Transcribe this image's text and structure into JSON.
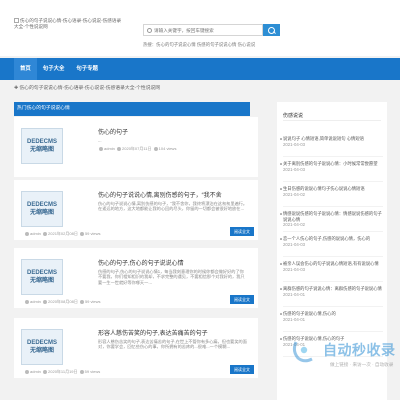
{
  "header": {
    "logo_alt": "伤心的句子说说心情-伤心语录-伤心说说-伤感语录大全-个性说说网",
    "search_placeholder": "请输入关键字，按回车键搜索",
    "hot_words": "热搜：伤心的句子说说心情  伤感的句子说说心情  伤心说说"
  },
  "nav": {
    "items": [
      "首页",
      "句子大全",
      "句子专题"
    ]
  },
  "breadcrumb": "伤心的句子说说心情-伤心语录-伤心说说-伤感语录大全-个性说说网",
  "list_header": "热门伤心的句子说说心情",
  "thumb_lines": [
    "DEDECMS",
    "无缩略图"
  ],
  "posts": [
    {
      "title": "伤心的句子",
      "desc": "...",
      "author": "admin",
      "date": "2020年07月11日",
      "views": "104 views",
      "readmore": "阅读全文"
    },
    {
      "title": "伤心的句子说说心情,离别伤感的句子，“我不舍",
      "desc": "伤心的句子说说心情,离别伤感的句子，“我不舍你，我终将漂泊在这匆匆里遍行。在遥远的地方，这大地都能让我的心回的尽头，你留的一切都会被很好地放在…",
      "author": "admin",
      "date": "2021年02月08日",
      "views": "59 views",
      "readmore": "阅读全文"
    },
    {
      "title": "伤心的句子,伤心的句子说说心情",
      "desc": "伤感的句子,伤心的句子说说心情1，每当我刻意理你的时候你都会做好好的了你不要我，你们相知相识的我却，不求完整的遇见，不要相信那个对我好的，我只要一生一世就好等你哪天一…",
      "author": "admin",
      "date": "2020年08月08日",
      "views": "59 views",
      "readmore": "阅读全文"
    },
    {
      "title": "形容人慈伤苦笑的句子,表达苦痛苦的句子",
      "desc": "形容人慈伤苦笑的句子,表达苦痛苦的句子,在世上不管你有多心痛，但也要笑的面对，你要学会，回忆些伤心的事，你所拥有的苦疼的...很难...一个模糊…",
      "author": "admin",
      "date": "2020年11月19日",
      "views": "59 views",
      "readmore": "阅读全文"
    }
  ],
  "sidebar": {
    "title": "伤感说说",
    "items": [
      {
        "text": "说说句子 心情短语,简单说说短句 心情短语",
        "date": "2021-04-03"
      },
      {
        "text": "关于离别伤感的句子说说心情：小时候常常尝愿望",
        "date": "2021-04-03"
      },
      {
        "text": "生日伤感的说说心情句子伤心说说心情短语",
        "date": "2021-04-02"
      },
      {
        "text": "情感说说伤感的句子说说心情：情感说说伤感的句子说说心情",
        "date": "2021-04-02"
      },
      {
        "text": "恋一个人伤心的句子,伤感的说说心情，伤心的",
        "date": "2021-04-03"
      },
      {
        "text": "被亲人误会伤心的句子说说心情短语,有有说说心情",
        "date": "2021-04-03"
      },
      {
        "text": "离群伤感的句子说说心情：离群伤感的句子说说心情",
        "date": "2021-04-01"
      },
      {
        "text": "伤感的句子说说心情,伤心的",
        "date": "2021-04-01"
      },
      {
        "text": "伤感的句子说说心情,伤心的句子",
        "date": "2021-04-01"
      }
    ]
  },
  "watermark": {
    "text": "自动秒收录",
    "sub": "做上链接 · 来访一次 · 自动收录"
  },
  "colors": {
    "brand": "#1976c9",
    "nav_active": "#2f87d6",
    "background": "#f2f2f2"
  }
}
